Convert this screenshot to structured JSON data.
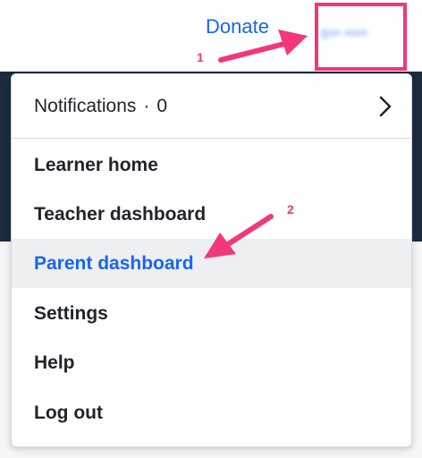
{
  "header": {
    "donate_label": "Donate",
    "username": "s•• ••••"
  },
  "menu": {
    "notifications": {
      "label": "Notifications",
      "separator": "·",
      "count": "0"
    },
    "items": [
      {
        "label": "Learner home"
      },
      {
        "label": "Teacher dashboard"
      },
      {
        "label": "Parent dashboard",
        "active": true
      },
      {
        "label": "Settings"
      },
      {
        "label": "Help"
      },
      {
        "label": "Log out"
      }
    ]
  },
  "annotations": {
    "step1": "1",
    "step2": "2",
    "color": "#f2377b"
  },
  "colors": {
    "accent": "#1865f2",
    "text": "#21242c",
    "dark_background": "#1e2b3f"
  }
}
